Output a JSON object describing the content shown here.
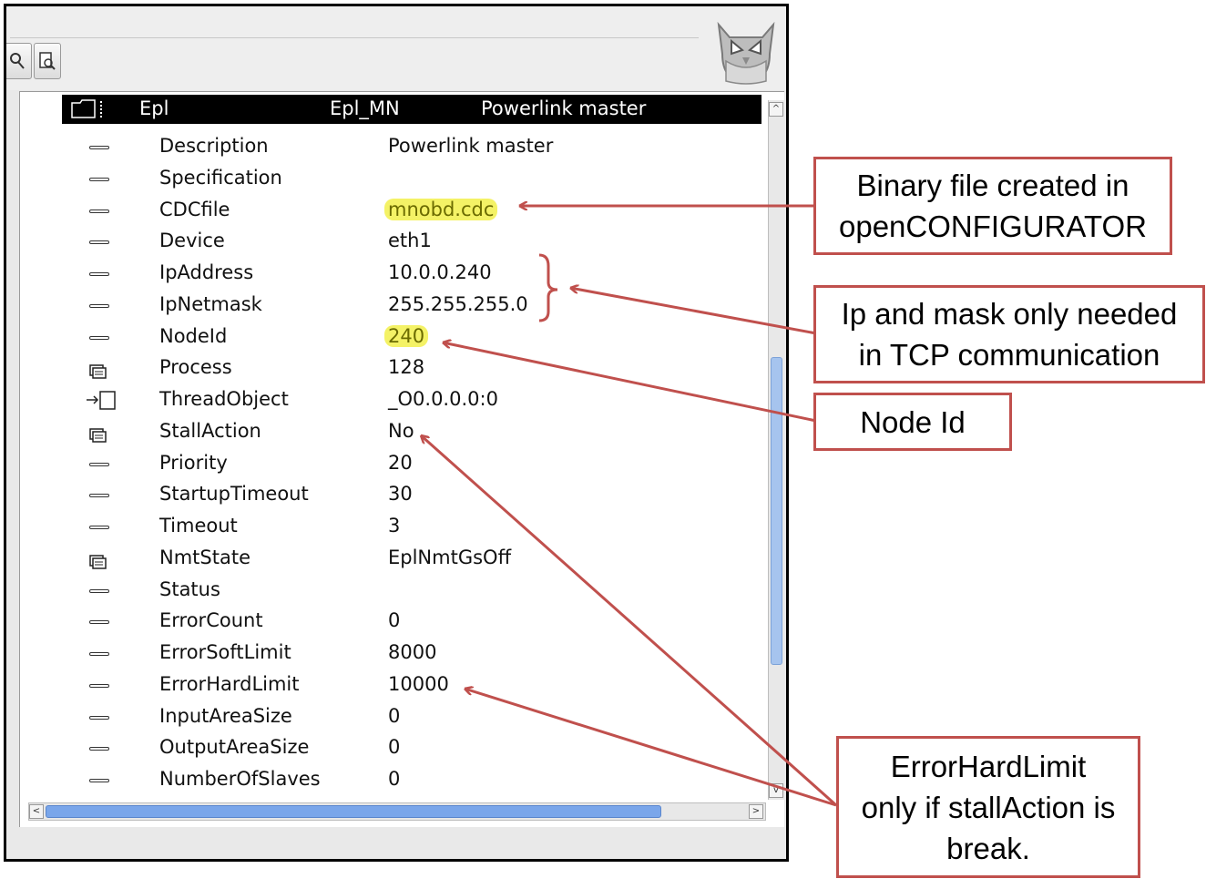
{
  "tree_header": {
    "name": "Epl",
    "class": "Epl_MN",
    "description": "Powerlink master"
  },
  "attributes": [
    {
      "icon": "dash-icon",
      "name": "Description",
      "value": "Powerlink master",
      "highlight": false
    },
    {
      "icon": "dash-icon",
      "name": "Specification",
      "value": "",
      "highlight": false
    },
    {
      "icon": "dash-icon",
      "name": "CDCfile",
      "value": "mnobd.cdc",
      "highlight": true
    },
    {
      "icon": "dash-icon",
      "name": "Device",
      "value": "eth1",
      "highlight": false
    },
    {
      "icon": "dash-icon",
      "name": "IpAddress",
      "value": "10.0.0.240",
      "highlight": false
    },
    {
      "icon": "dash-icon",
      "name": "IpNetmask",
      "value": "255.255.255.0",
      "highlight": false
    },
    {
      "icon": "dash-icon",
      "name": "NodeId",
      "value": "240",
      "highlight": true
    },
    {
      "icon": "folder-stack-icon",
      "name": "Process",
      "value": "128",
      "highlight": false
    },
    {
      "icon": "reference-arrow-icon",
      "name": "ThreadObject",
      "value": "_O0.0.0.0:0",
      "highlight": false
    },
    {
      "icon": "folder-stack-icon",
      "name": "StallAction",
      "value": "No",
      "highlight": false
    },
    {
      "icon": "dash-icon",
      "name": "Priority",
      "value": "20",
      "highlight": false
    },
    {
      "icon": "dash-icon",
      "name": "StartupTimeout",
      "value": "30",
      "highlight": false
    },
    {
      "icon": "dash-icon",
      "name": "Timeout",
      "value": "3",
      "highlight": false
    },
    {
      "icon": "folder-stack-icon",
      "name": "NmtState",
      "value": "EplNmtGsOff",
      "highlight": false
    },
    {
      "icon": "dash-icon",
      "name": "Status",
      "value": "",
      "highlight": false
    },
    {
      "icon": "dash-icon",
      "name": "ErrorCount",
      "value": "0",
      "highlight": false
    },
    {
      "icon": "dash-icon",
      "name": "ErrorSoftLimit",
      "value": "8000",
      "highlight": false
    },
    {
      "icon": "dash-icon",
      "name": "ErrorHardLimit",
      "value": "10000",
      "highlight": false
    },
    {
      "icon": "dash-icon",
      "name": "InputAreaSize",
      "value": "0",
      "highlight": false
    },
    {
      "icon": "dash-icon",
      "name": "OutputAreaSize",
      "value": "0",
      "highlight": false
    },
    {
      "icon": "dash-icon",
      "name": "NumberOfSlaves",
      "value": "0",
      "highlight": false
    }
  ],
  "callouts": {
    "binary": [
      "Binary file created in",
      "openCONFIGURATOR"
    ],
    "ip": [
      "Ip and mask only needed",
      "in TCP communication"
    ],
    "nodeid": [
      "Node Id"
    ],
    "errorhard": [
      "ErrorHardLimit",
      "only if stallAction is",
      "break."
    ]
  },
  "colors": {
    "callout_border": "#c0504d",
    "highlight": "#f4f266",
    "selection": "#000000"
  }
}
